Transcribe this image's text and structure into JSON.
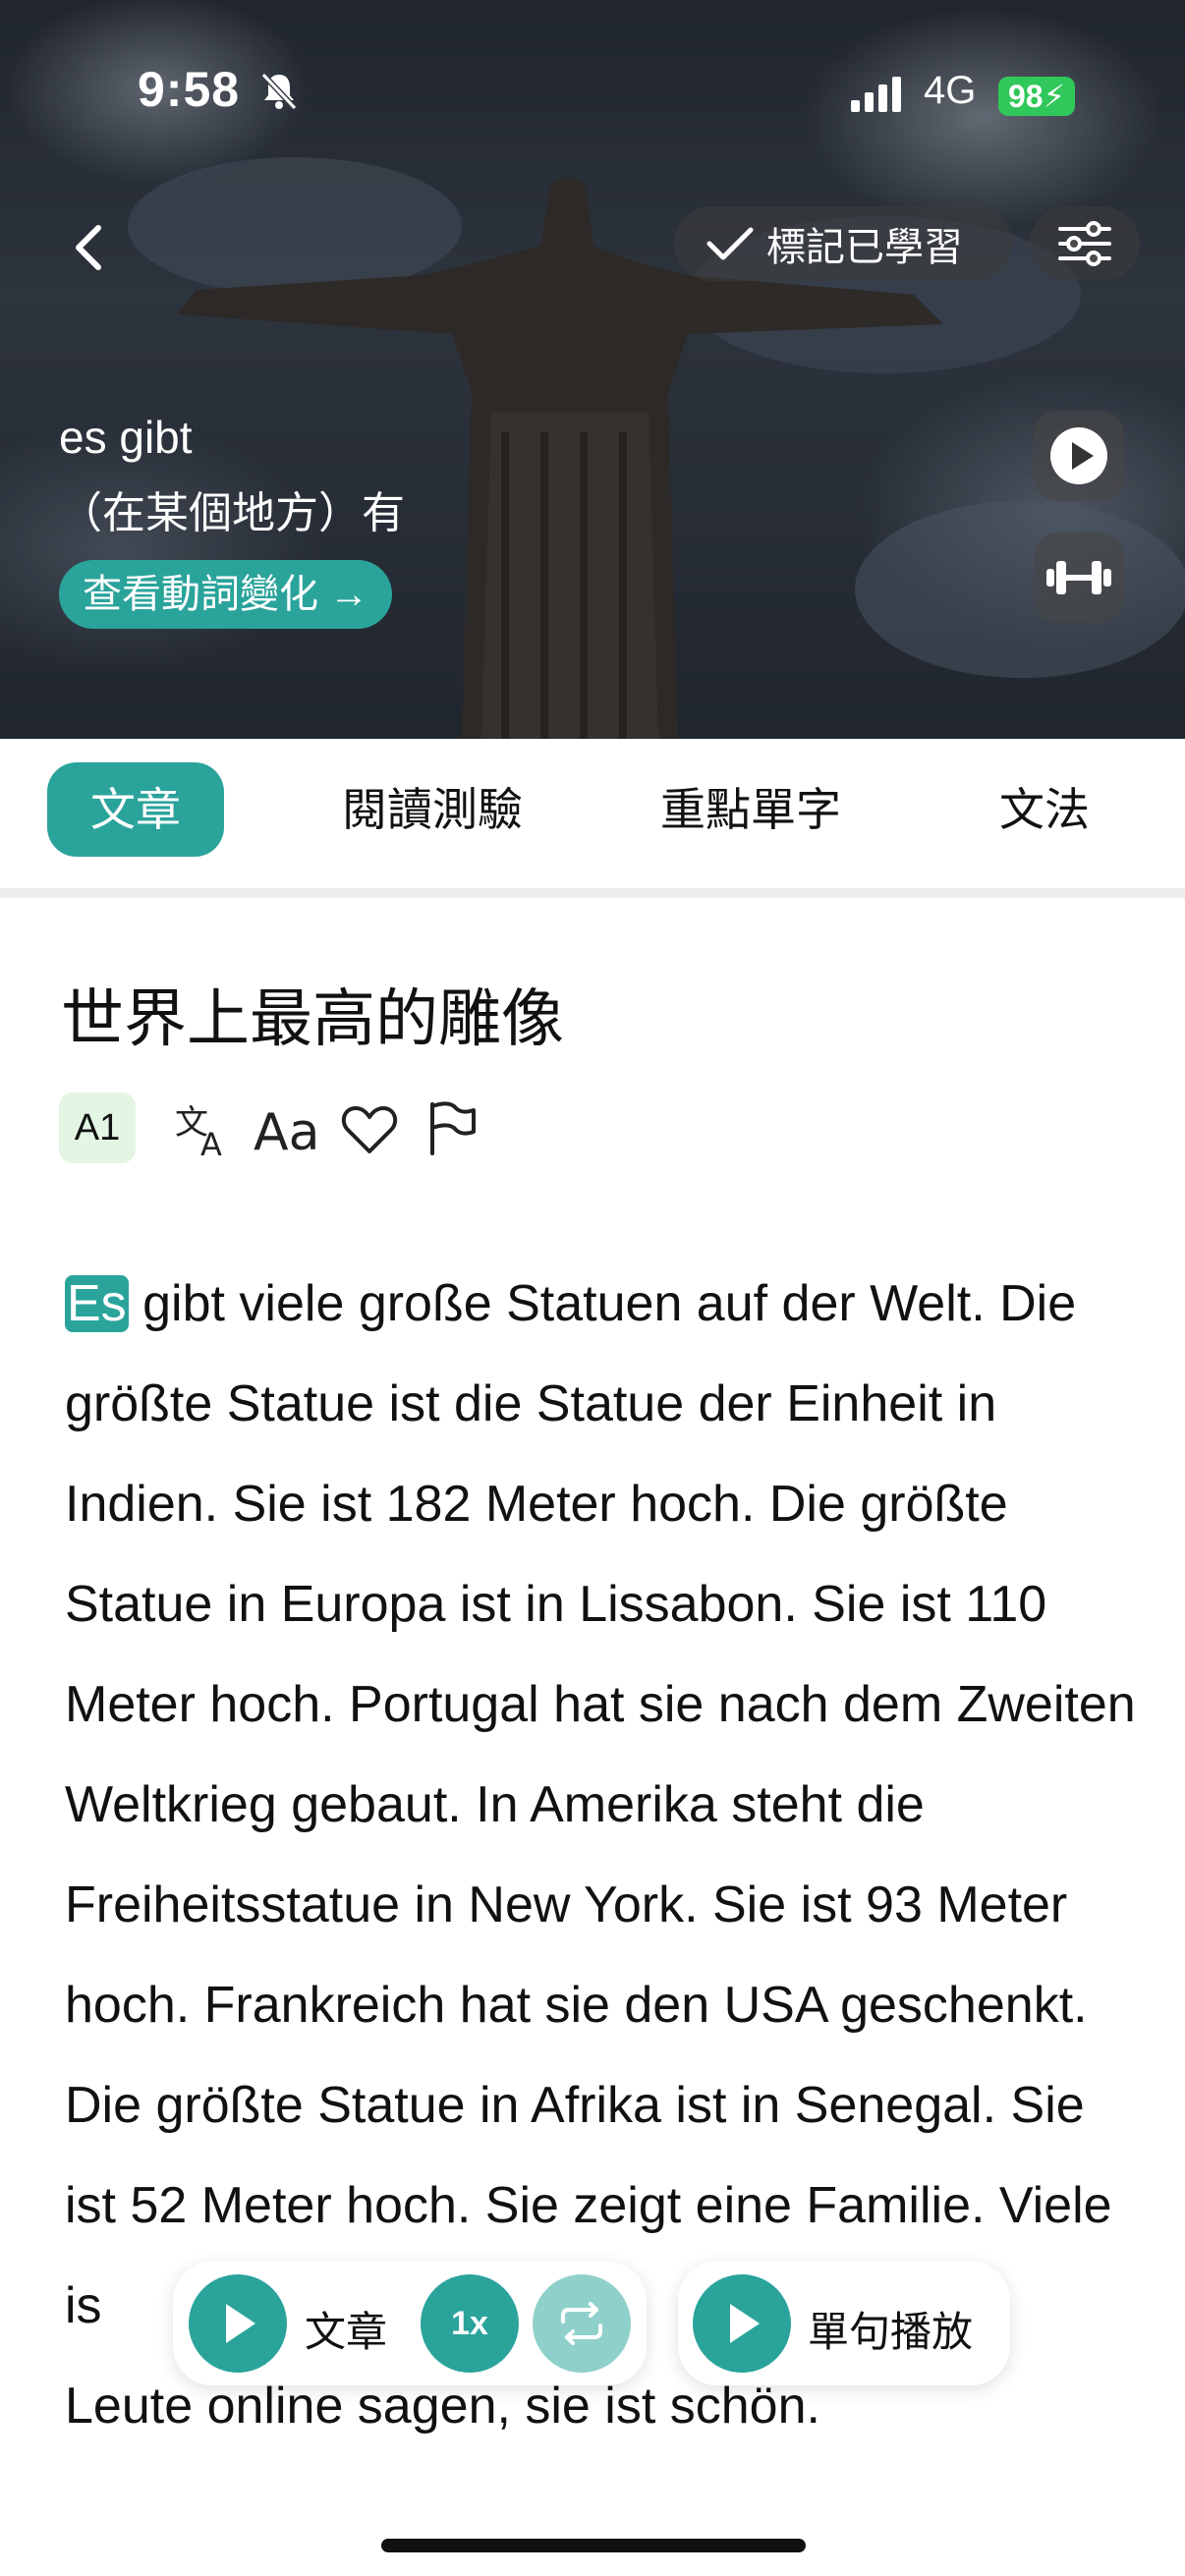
{
  "status": {
    "time": "9:58",
    "network": "4G",
    "battery": "98"
  },
  "header": {
    "mark_learned_label": "標記已學習"
  },
  "hero": {
    "word": "es gibt",
    "meaning": "（在某個地方）有",
    "conjugation_link": "查看動詞變化 →"
  },
  "tabs": [
    {
      "label": "文章",
      "active": true
    },
    {
      "label": "閱讀測驗"
    },
    {
      "label": "重點單字"
    },
    {
      "label": "文法"
    }
  ],
  "article": {
    "title": "世界上最高的雕像",
    "level": "A1",
    "highlighted_word": "Es",
    "text_rest": " gibt viele große Statuen auf der Welt. Die größte Statue ist die Statue der Einheit in Indien. Sie ist 182 Meter hoch. Die größte Statue in Europa ist in Lissabon. Sie ist 110 Meter hoch. Portugal hat sie nach dem Zweiten Weltkrieg gebaut. In Amerika steht die Freiheitsstatue in New York. Sie ist 93 Meter hoch. Frankreich hat sie den USA geschenkt. Die größte Statue in Afrika ist in Senegal. Sie ist 52 Meter hoch. Sie zeigt",
    "text_hidden_mid": " eine Familie. Viele ",
    "text_visible_is": "is",
    "text_last_line": "Leute online sagen, sie ist schön."
  },
  "player": {
    "article_label": "文章",
    "speed": "1x",
    "sentence_label": "單句播放"
  },
  "colors": {
    "accent": "#2aa39b",
    "accent_light": "#8fd0cb",
    "battery_green": "#30c85a"
  }
}
